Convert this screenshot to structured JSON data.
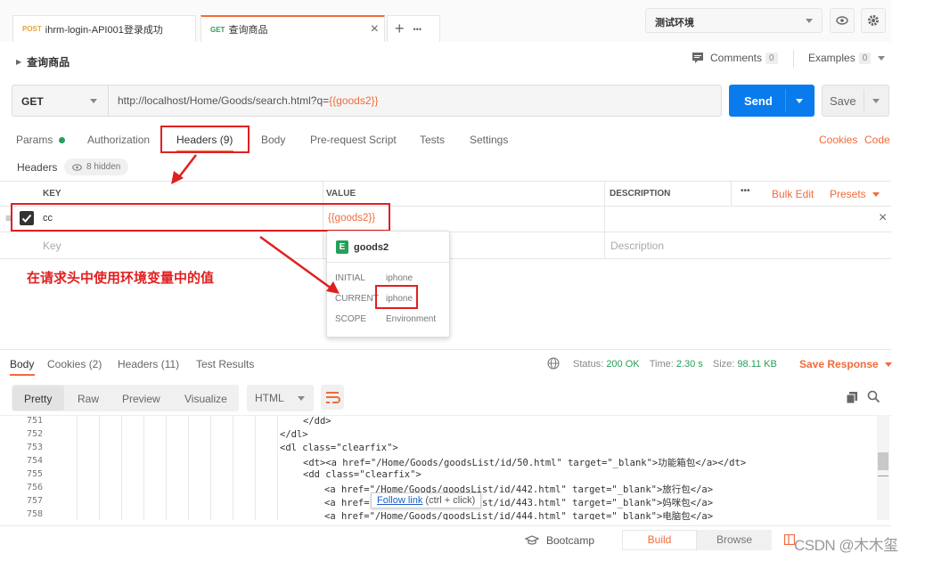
{
  "tabs": [
    {
      "method": "POST",
      "title": "ihrm-login-API001登录成功"
    },
    {
      "method": "GET",
      "title": "查询商品"
    }
  ],
  "tab_close": "×",
  "tab_plus": "+",
  "tab_more": "•••",
  "environment": "测试环境",
  "request_title": "查询商品",
  "comments_label": "Comments",
  "comments_count": "0",
  "examples_label": "Examples",
  "examples_count": "0",
  "method": "GET",
  "url_base": "http://localhost/Home/Goods/search.html?q=",
  "url_var": "{{goods2}}",
  "send_label": "Send",
  "save_label": "Save",
  "request_tabs": {
    "params": "Params",
    "authorization": "Authorization",
    "headers": "Headers (9)",
    "body": "Body",
    "prerequest": "Pre-request Script",
    "tests": "Tests",
    "settings": "Settings",
    "cookies": "Cookies",
    "code": "Code"
  },
  "headers_label": "Headers",
  "hidden_label": "8 hidden",
  "table": {
    "key_header": "KEY",
    "value_header": "VALUE",
    "description_header": "DESCRIPTION",
    "more": "•••",
    "bulk_edit": "Bulk Edit",
    "presets": "Presets",
    "row_key": "cc",
    "row_value": "{{goods2}}",
    "key_placeholder": "Key",
    "description_placeholder": "Description",
    "delete": "×"
  },
  "popover": {
    "badge": "E",
    "name": "goods2",
    "initial_label": "INITIAL",
    "initial_value": "iphone",
    "current_label": "CURRENT",
    "current_value": "iphone",
    "scope_label": "SCOPE",
    "scope_value": "Environment"
  },
  "annotation": "在请求头中使用环境变量中的值",
  "response": {
    "tabs": {
      "body": "Body",
      "cookies": "Cookies (2)",
      "headers": "Headers (11)",
      "tests": "Test Results"
    },
    "status_label": "Status:",
    "status_value": "200 OK",
    "time_label": "Time:",
    "time_value": "2.30 s",
    "size_label": "Size:",
    "size_value": "98.11 KB",
    "save_response": "Save Response",
    "views": [
      "Pretty",
      "Raw",
      "Preview",
      "Visualize"
    ],
    "format": "HTML",
    "lines": [
      {
        "n": "751",
        "t": "</dd>"
      },
      {
        "n": "752",
        "t": "</dl>"
      },
      {
        "n": "753",
        "t": "<dl class=\"clearfix\">"
      },
      {
        "n": "754",
        "t": "<dt><a href=\"/Home/Goods/goodsList/id/50.html\" target=\"_blank\">功能箱包</a></dt>"
      },
      {
        "n": "755",
        "t": "<dd class=\"clearfix\">"
      },
      {
        "n": "756",
        "t": "<a href=\"/Home/Goods/goodsList/id/442.html\" target=\"_blank\">旅行包</a>"
      },
      {
        "n": "757",
        "t": "<a href=\"/Home/Goods/goodsList/id/443.html\" target=\"_blank\">妈咪包</a>"
      },
      {
        "n": "758",
        "t": "<a href=\"/Home/Goods/goodsList/id/444.html\" target=\"_blank\">电脑包</a>"
      }
    ],
    "tooltip_link": "Follow link",
    "tooltip_hint": "(ctrl + click)"
  },
  "footer": {
    "bootcamp": "Bootcamp",
    "build": "Build",
    "browse": "Browse",
    "watermark": "CSDN @木木玺"
  }
}
